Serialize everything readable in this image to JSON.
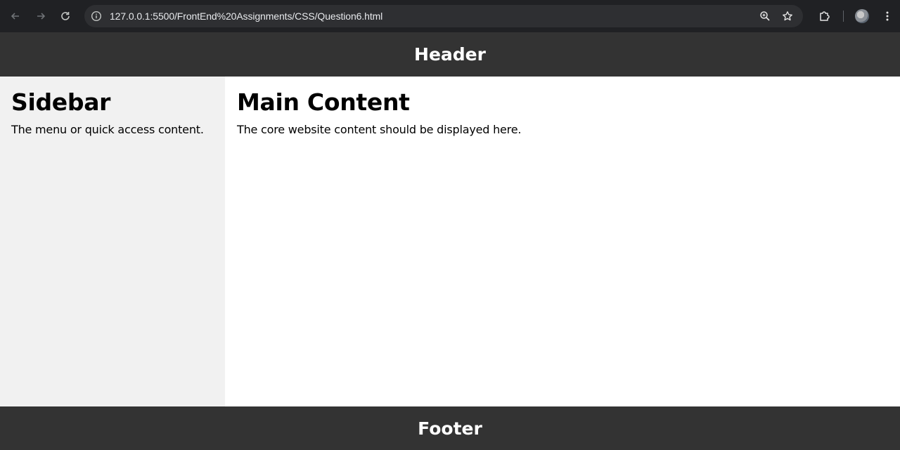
{
  "browser": {
    "url": "127.0.0.1:5500/FrontEnd%20Assignments/CSS/Question6.html",
    "icons": [
      "back-icon",
      "forward-icon",
      "reload-icon",
      "site-info-icon",
      "zoom-icon",
      "bookmark-star-icon",
      "extensions-icon",
      "profile-avatar",
      "menu-icon"
    ]
  },
  "page": {
    "header": "Header",
    "sidebar": {
      "title": "Sidebar",
      "text": "The menu or quick access content."
    },
    "main": {
      "title": "Main Content",
      "text": "The core website content should be displayed here."
    },
    "footer": "Footer"
  },
  "colors": {
    "header_bg": "#333333",
    "sidebar_bg": "#f1f1f1",
    "footer_bg": "#333333"
  }
}
